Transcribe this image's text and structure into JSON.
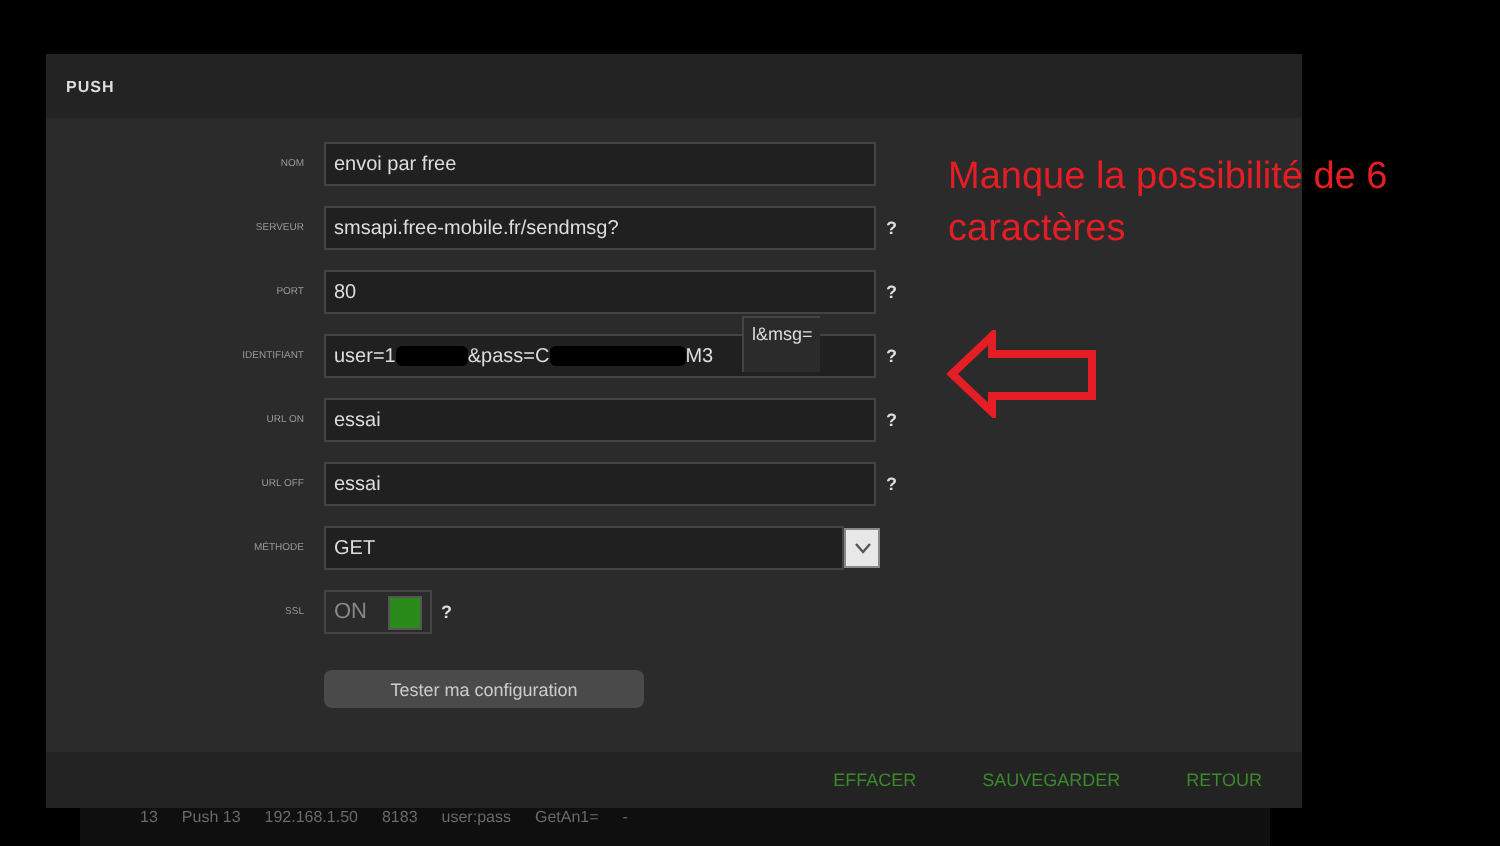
{
  "dialog": {
    "title": "PUSH"
  },
  "fields": [
    {
      "kind": "text",
      "label": "NOM",
      "value": "envoi par free"
    },
    {
      "kind": "text",
      "label": "SERVEUR",
      "value": "smsapi.free-mobile.fr/sendmsg?",
      "help": "?"
    },
    {
      "kind": "text",
      "label": "PORT",
      "value": "80",
      "help": "?"
    },
    {
      "kind": "masked",
      "label": "IDENTIFIANT",
      "parts": [
        "user=1",
        "&pass=C",
        "M3"
      ],
      "overlay": "l&msg=",
      "help": "?"
    },
    {
      "kind": "text",
      "label": "URL ON",
      "value": "essai",
      "help": "?"
    },
    {
      "kind": "text",
      "label": "URL OFF",
      "value": "essai",
      "help": "?"
    },
    {
      "kind": "select",
      "label": "MÉTHODE",
      "value": "GET"
    },
    {
      "kind": "toggle",
      "label": "SSL",
      "value": "ON",
      "on": true,
      "help": "?"
    }
  ],
  "test_button": "Tester ma configuration",
  "footer_buttons": [
    "EFFACER",
    "SAUVEGARDER",
    "RETOUR"
  ],
  "background_table": {
    "rows": [
      [
        "13",
        "Push 13",
        "192.168.1.50",
        "8183",
        "user:pass",
        "GetAn1=",
        "-"
      ]
    ]
  },
  "annotation": {
    "text": "Manque la possibilité de 6 caractères"
  }
}
